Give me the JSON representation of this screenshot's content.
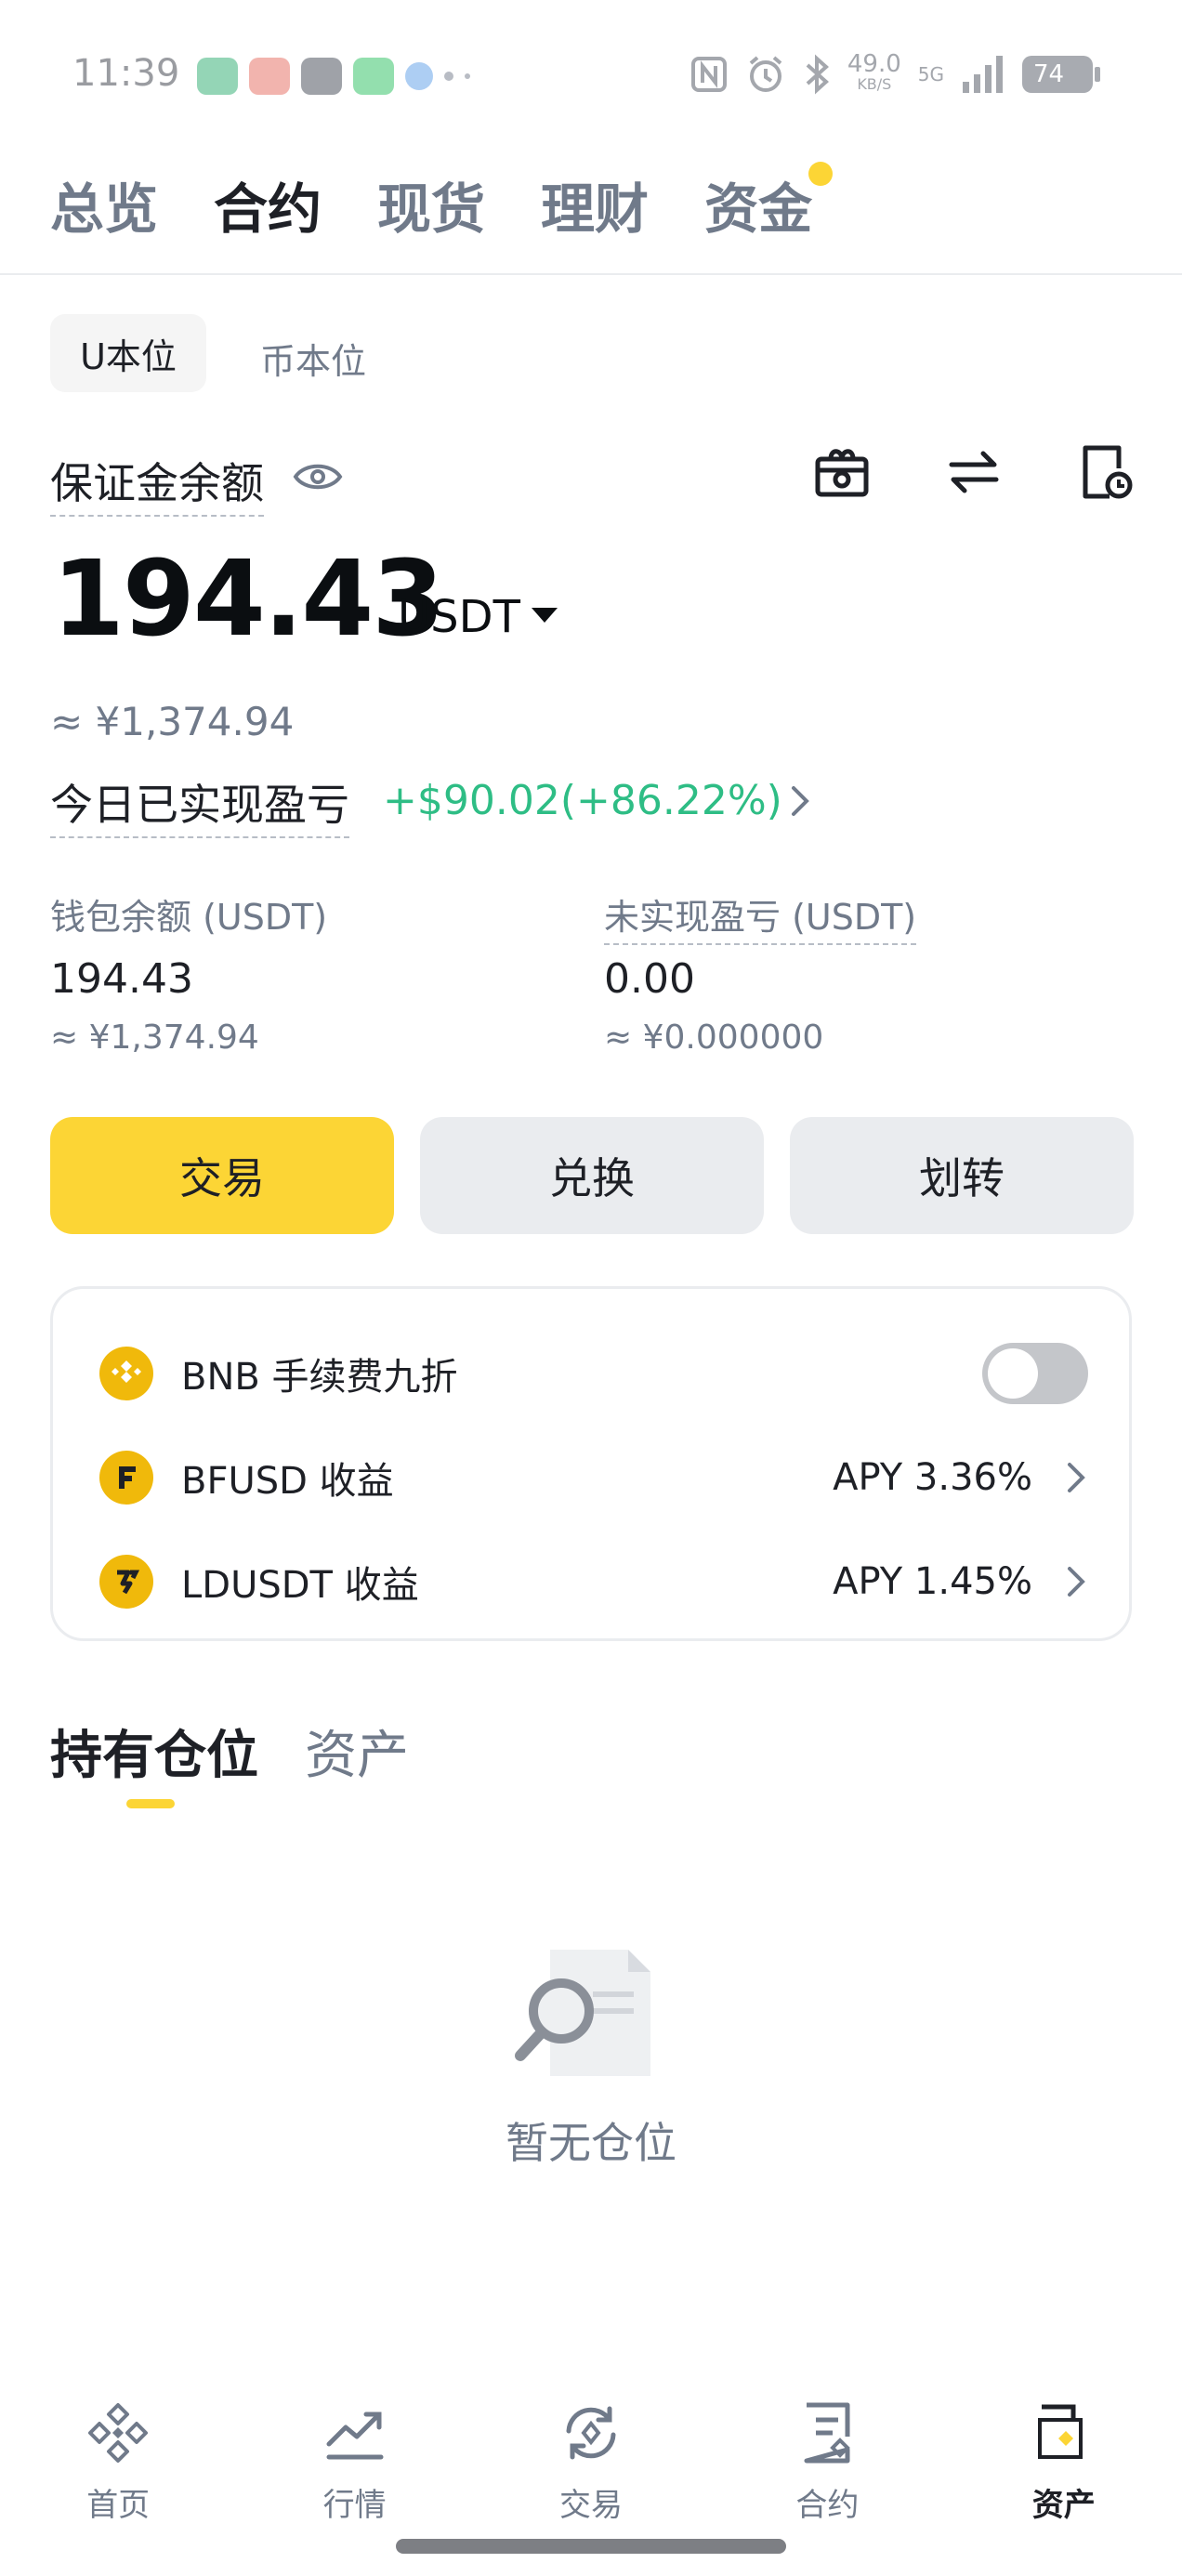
{
  "status_bar": {
    "time": "11:39",
    "network_speed": "49.0",
    "network_speed_unit": "KB/S",
    "signal_label": "5G",
    "battery": "74"
  },
  "top_tabs": [
    {
      "label": "总览",
      "active": false
    },
    {
      "label": "合约",
      "active": true
    },
    {
      "label": "现货",
      "active": false
    },
    {
      "label": "理财",
      "active": false
    },
    {
      "label": "资金",
      "active": false,
      "badge_dot": true
    }
  ],
  "sub_tabs": {
    "active": "U本位",
    "other": "币本位"
  },
  "margin": {
    "label": "保证金余额",
    "balance": "194.43",
    "unit": "USDT",
    "approx_cny": "≈ ¥1,374.94"
  },
  "todays_pnl": {
    "label": "今日已实现盈亏",
    "value": "+$90.02(+86.22%)",
    "color": "#2ebd85"
  },
  "wallet": {
    "label": "钱包余额 (USDT)",
    "value": "194.43",
    "approx": "≈ ¥1,374.94"
  },
  "unrealized": {
    "label": "未实现盈亏 (USDT)",
    "value": "0.00",
    "approx": "≈ ¥0.000000"
  },
  "actions": {
    "trade": "交易",
    "convert": "兑换",
    "transfer": "划转"
  },
  "features": [
    {
      "label": "BNB 手续费九折",
      "control": "toggle",
      "on": false
    },
    {
      "label": "BFUSD 收益",
      "apy": "APY 3.36%"
    },
    {
      "label": "LDUSDT 收益",
      "apy": "APY 1.45%"
    }
  ],
  "holdings": {
    "tab_positions": "持有仓位",
    "tab_assets": "资产",
    "empty_text": "暂无仓位"
  },
  "bottom_nav": [
    {
      "label": "首页",
      "icon": "home-icon",
      "active": false
    },
    {
      "label": "行情",
      "icon": "markets-icon",
      "active": false
    },
    {
      "label": "交易",
      "icon": "trade-icon",
      "active": false
    },
    {
      "label": "合约",
      "icon": "futures-icon",
      "active": false
    },
    {
      "label": "资产",
      "icon": "wallet-icon",
      "active": true
    }
  ],
  "colors": {
    "accent": "#fcd535",
    "positive": "#2ebd85",
    "text_primary": "#1e2026",
    "text_secondary": "#707a8a"
  }
}
